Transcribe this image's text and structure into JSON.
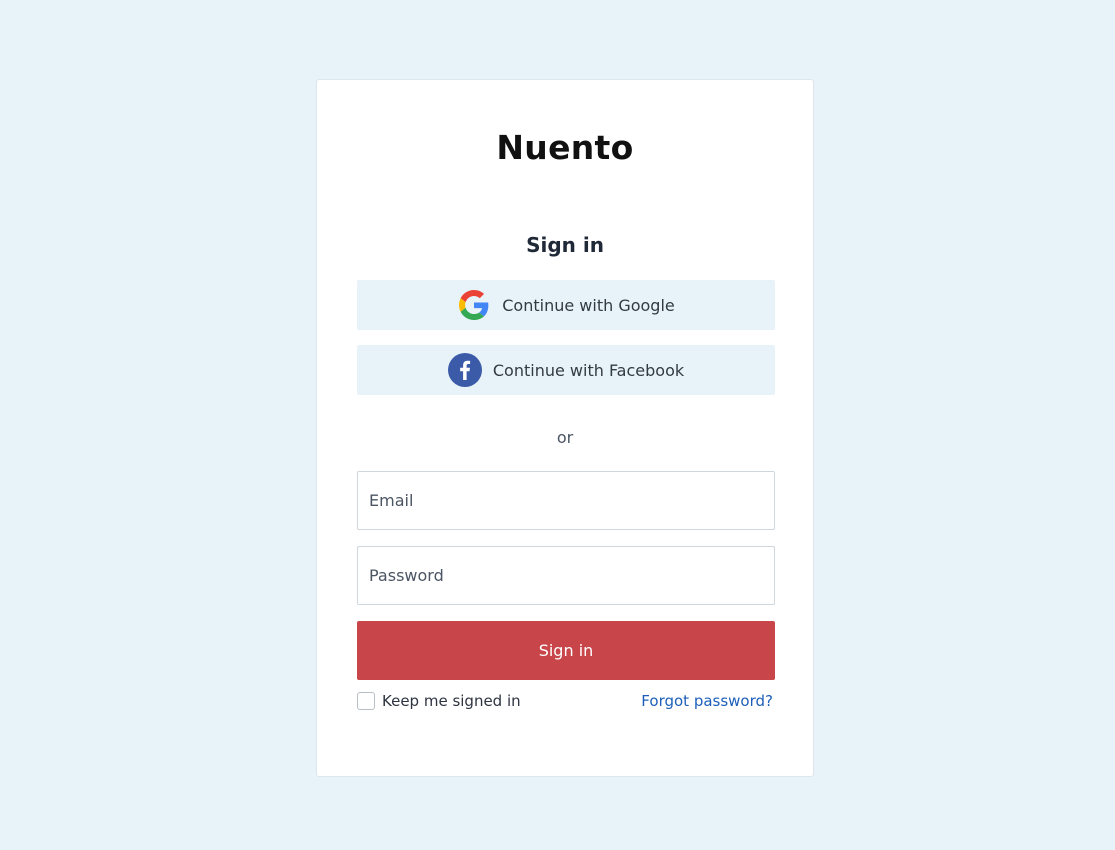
{
  "brand": {
    "name": "Nuento"
  },
  "signin": {
    "heading": "Sign in",
    "google_label": "Continue with Google",
    "facebook_label": "Continue with Facebook",
    "separator": "or",
    "email_placeholder": "Email",
    "password_placeholder": "Password",
    "submit_label": "Sign in",
    "remember_label": "Keep me signed in",
    "forgot_label": "Forgot password?"
  },
  "icons": {
    "google": "google-g-icon",
    "facebook": "facebook-f-icon"
  },
  "colors": {
    "background": "#e8f2f9",
    "primary_button": "#c8464a",
    "link": "#1d5fb8",
    "facebook_blue": "#3b5ba9"
  }
}
